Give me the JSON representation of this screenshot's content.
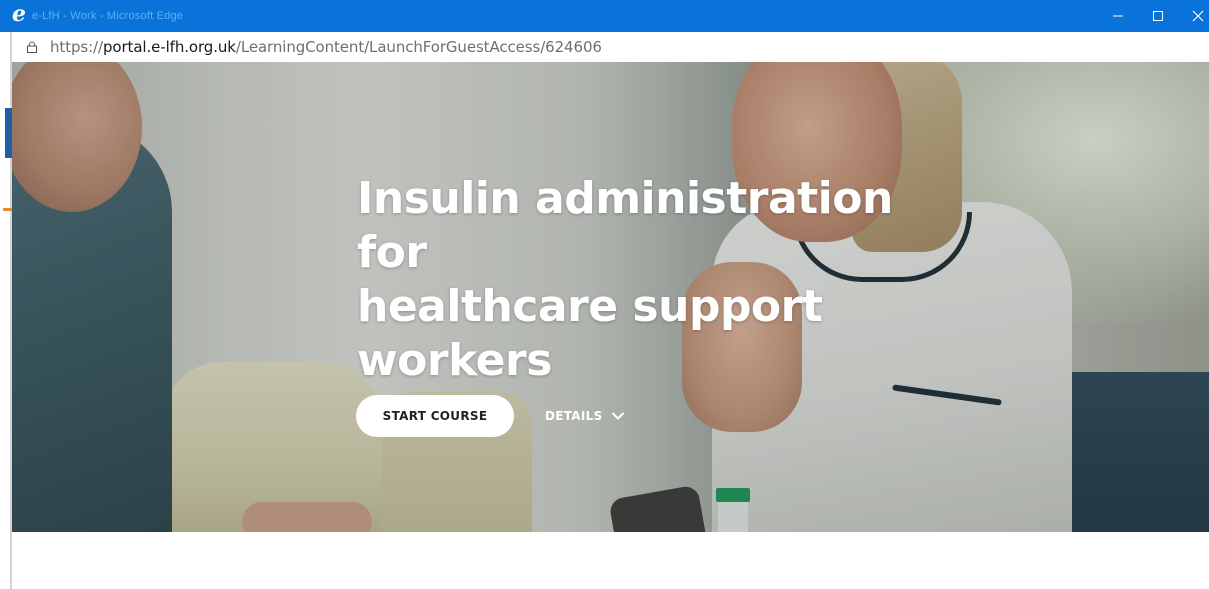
{
  "window": {
    "title": "e-LfH - Work - Microsoft Edge",
    "controls": [
      "minimize",
      "maximize",
      "close"
    ]
  },
  "addressbar": {
    "url_prefix": "https://",
    "url_domain": "portal.e-lfh.org.uk",
    "url_path": "/LearningContent/LaunchForGuestAccess/624606"
  },
  "hero": {
    "title_lines": [
      "Insulin administration for",
      "healthcare support",
      "workers"
    ],
    "start_label": "START COURSE",
    "details_label": "DETAILS"
  },
  "colors": {
    "titlebar": "#0a73d9",
    "title_text": "#ffffff",
    "button_bg": "#ffffff"
  },
  "icons": {
    "browser": "edge-icon",
    "lock": "lock-icon",
    "details": "chevron-down-icon"
  }
}
